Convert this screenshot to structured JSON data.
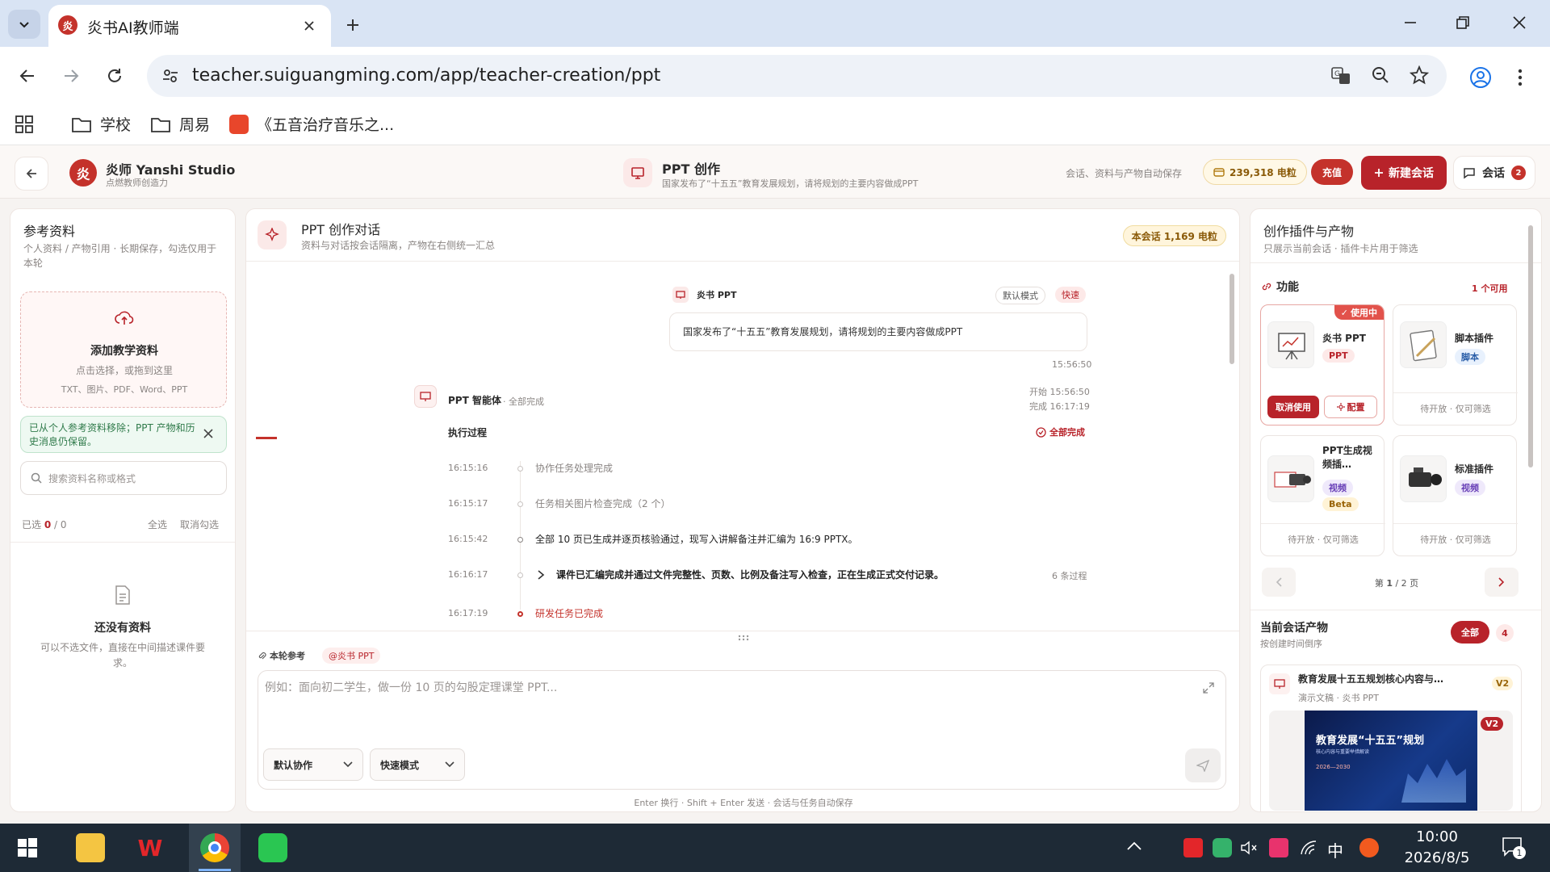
{
  "browser": {
    "tab_title": "炎书AI教师端",
    "url": "teacher.suiguangming.com/app/teacher-creation/ppt",
    "bookmarks": [
      {
        "label": "学校"
      },
      {
        "label": "周易"
      },
      {
        "label": "《五音治疗音乐之..."
      }
    ]
  },
  "header": {
    "logo_char": "炎",
    "brand": "炎师 Yanshi Studio",
    "tagline": "点燃教师创造力",
    "page_title": "PPT 创作",
    "page_subtitle": "国家发布了“十五五”教育发展规划，请将规划的主要内容做成PPT",
    "autosave": "会话、资料与产物自动保存",
    "credits": "239,318 电粒",
    "recharge": "充值",
    "new_session": "新建会话",
    "sessions_label": "会话",
    "sessions_count": "2"
  },
  "left": {
    "title": "参考资料",
    "desc": "个人资料 / 产物引用 · 长期保存，勾选仅用于本轮",
    "upload_title": "添加教学资料",
    "upload_hint": "点击选择，或拖到这里",
    "upload_formats": "TXT、图片、PDF、Word、PPT",
    "notice": "已从个人参考资料移除；PPT 产物和历史消息仍保留。",
    "search_placeholder": "搜索资料名称或格式",
    "selected_label": "已选",
    "selected_count": "0",
    "selected_total": "/ 0",
    "select_all": "全选",
    "clear": "取消勾选",
    "empty_title": "还没有资料",
    "empty_desc": "可以不选文件，直接在中间描述课件要求。"
  },
  "center": {
    "title": "PPT 创作对话",
    "subtitle": "资料与对话按会话隔离，产物在右侧统一汇总",
    "session_credits": "本会话 1,169 电粒",
    "user_msg": {
      "sender": "炎书 PPT",
      "tag_mode": "默认模式",
      "tag_speed": "快速",
      "text": "国家发布了“十五五”教育发展规划，请将规划的主要内容做成PPT",
      "time": "15:56:50"
    },
    "agent": {
      "name": "PPT 智能体",
      "status": "· 全部完成",
      "start": "开始 15:56:50",
      "end": "完成 16:17:19",
      "process_title": "执行过程",
      "process_status": "全部完成",
      "steps": [
        {
          "time": "16:15:16",
          "text": "协作任务处理完成",
          "style": "muted"
        },
        {
          "time": "16:15:17",
          "text": "任务相关图片检查完成（2 个）",
          "style": "muted"
        },
        {
          "time": "16:15:42",
          "text": "全部 10 页已生成并逐页核验通过，现写入讲解备注并汇编为 16:9 PPTX。",
          "style": "dark"
        },
        {
          "time": "16:16:17",
          "text": "课件已汇编完成并通过文件完整性、页数、比例及备注写入检查，正在生成正式交付记录。",
          "style": "bold",
          "extra": "6 条过程"
        },
        {
          "time": "16:17:19",
          "text": "研发任务已完成",
          "style": "red"
        }
      ]
    },
    "composer": {
      "ref_label": "本轮参考",
      "ref_chip": "@炎书 PPT",
      "placeholder": "例如：面向初二学生，做一份 10 页的勾股定理课堂 PPT...",
      "select1": "默认协作",
      "select2": "快速模式",
      "hint": "Enter 换行 · Shift + Enter 发送 · 会话与任务自动保存"
    }
  },
  "right": {
    "title": "创作插件与产物",
    "subtitle": "只展示当前会话 · 插件卡片用于筛选",
    "features_label": "功能",
    "available": "1 个可用",
    "plugins": [
      {
        "name": "炎书 PPT",
        "tag": "PPT",
        "badge": "使用中",
        "action1": "取消使用",
        "action2": "配置"
      },
      {
        "name": "脚本插件",
        "tag": "脚本",
        "status": "待开放 · 仅可筛选"
      },
      {
        "name": "PPT生成视频插…",
        "tag": "视频",
        "tag2": "Beta",
        "status": "待开放 · 仅可筛选"
      },
      {
        "name": "标准插件",
        "tag": "视频",
        "status": "待开放 · 仅可筛选"
      }
    ],
    "pager_prefix": "第",
    "pager_current": "1",
    "pager_suffix": "/ 2 页",
    "products_title": "当前会话产物",
    "products_sub": "按创建时间倒序",
    "filter_all": "全部",
    "products_count": "4",
    "product": {
      "title": "教育发展十五五规划核心内容与…",
      "version": "V2",
      "meta": "演示文稿 · 炎书 PPT",
      "thumb_title": "教育发展“十五五”规划",
      "thumb_sub": "核心内容与重要举措解读",
      "thumb_year": "2026—2030"
    }
  },
  "taskbar": {
    "time": "10:00",
    "date": "2026/8/5",
    "ime": "中",
    "notif": "1"
  }
}
